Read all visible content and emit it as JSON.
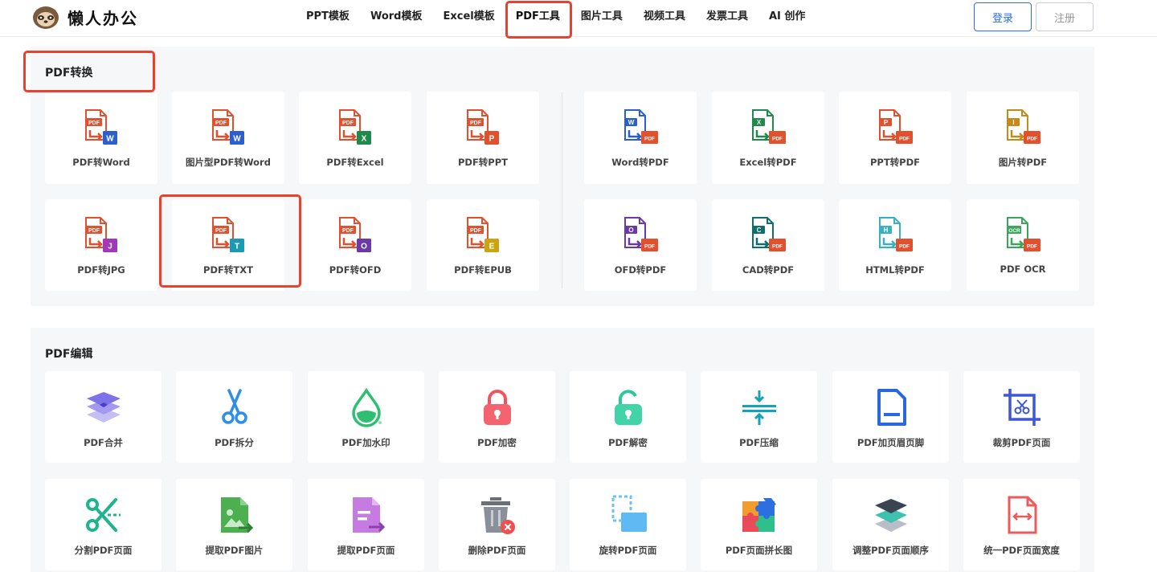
{
  "header": {
    "logo_text": "懒人办公",
    "nav": [
      "PPT模板",
      "Word模板",
      "Excel模板",
      "PDF工具",
      "图片工具",
      "视频工具",
      "发票工具",
      "AI 创作"
    ],
    "active_nav": "PDF工具",
    "login_label": "登录",
    "register_label": "注册"
  },
  "convert": {
    "title": "PDF转换",
    "row1_left": [
      {
        "label": "PDF转Word",
        "badge": "W",
        "color": "#2b5fcf"
      },
      {
        "label": "图片型PDF转Word",
        "badge": "W",
        "color": "#2b5fcf"
      },
      {
        "label": "PDF转Excel",
        "badge": "X",
        "color": "#1f8a4c"
      },
      {
        "label": "PDF转PPT",
        "badge": "P",
        "color": "#e2502d"
      }
    ],
    "row2_left": [
      {
        "label": "PDF转JPG",
        "badge": "J",
        "color": "#a238b8"
      },
      {
        "label": "PDF转TXT",
        "badge": "T",
        "color": "#1a9bb3"
      },
      {
        "label": "PDF转OFD",
        "badge": "O",
        "color": "#6b3aa6"
      },
      {
        "label": "PDF转EPUB",
        "badge": "E",
        "color": "#c9a60f"
      }
    ],
    "row1_right": [
      {
        "label": "Word转PDF",
        "doc": "W",
        "color": "#2b5fcf"
      },
      {
        "label": "Excel转PDF",
        "doc": "X",
        "color": "#1f8a4c"
      },
      {
        "label": "PPT转PDF",
        "doc": "P",
        "color": "#e2502d"
      },
      {
        "label": "图片转PDF",
        "doc": "I",
        "color": "#c58a1a"
      }
    ],
    "row2_right": [
      {
        "label": "OFD转PDF",
        "doc": "O",
        "color": "#6b3aa6"
      },
      {
        "label": "CAD转PDF",
        "doc": "C",
        "color": "#0f6e6e"
      },
      {
        "label": "HTML转PDF",
        "doc": "H",
        "color": "#36b3c2"
      },
      {
        "label": "PDF OCR",
        "doc": "OCR",
        "color": "#3aa65a"
      }
    ]
  },
  "edit": {
    "title": "PDF编辑",
    "row1": [
      {
        "label": "PDF合并",
        "icon": "layers-merge-icon"
      },
      {
        "label": "PDF拆分",
        "icon": "scissors-icon"
      },
      {
        "label": "PDF加水印",
        "icon": "water-drop-icon"
      },
      {
        "label": "PDF加密",
        "icon": "lock-icon"
      },
      {
        "label": "PDF解密",
        "icon": "unlock-icon"
      },
      {
        "label": "PDF压缩",
        "icon": "compress-icon"
      },
      {
        "label": "PDF加页眉页脚",
        "icon": "header-footer-icon"
      },
      {
        "label": "裁剪PDF页面",
        "icon": "crop-icon"
      }
    ],
    "row2": [
      {
        "label": "分割PDF页面",
        "icon": "split-scissors-icon"
      },
      {
        "label": "提取PDF图片",
        "icon": "extract-image-icon"
      },
      {
        "label": "提取PDF页面",
        "icon": "extract-page-icon"
      },
      {
        "label": "删除PDF页面",
        "icon": "trash-delete-icon"
      },
      {
        "label": "旋转PDF页面",
        "icon": "rotate-page-icon"
      },
      {
        "label": "PDF页面拼长图",
        "icon": "puzzle-icon"
      },
      {
        "label": "调整PDF页面顺序",
        "icon": "reorder-layers-icon"
      },
      {
        "label": "统一PDF页面宽度",
        "icon": "uniform-width-icon"
      }
    ]
  },
  "colors": {
    "accent": "#2a6df0",
    "highlight": "#e8422f",
    "pdf_red": "#e2502d"
  }
}
